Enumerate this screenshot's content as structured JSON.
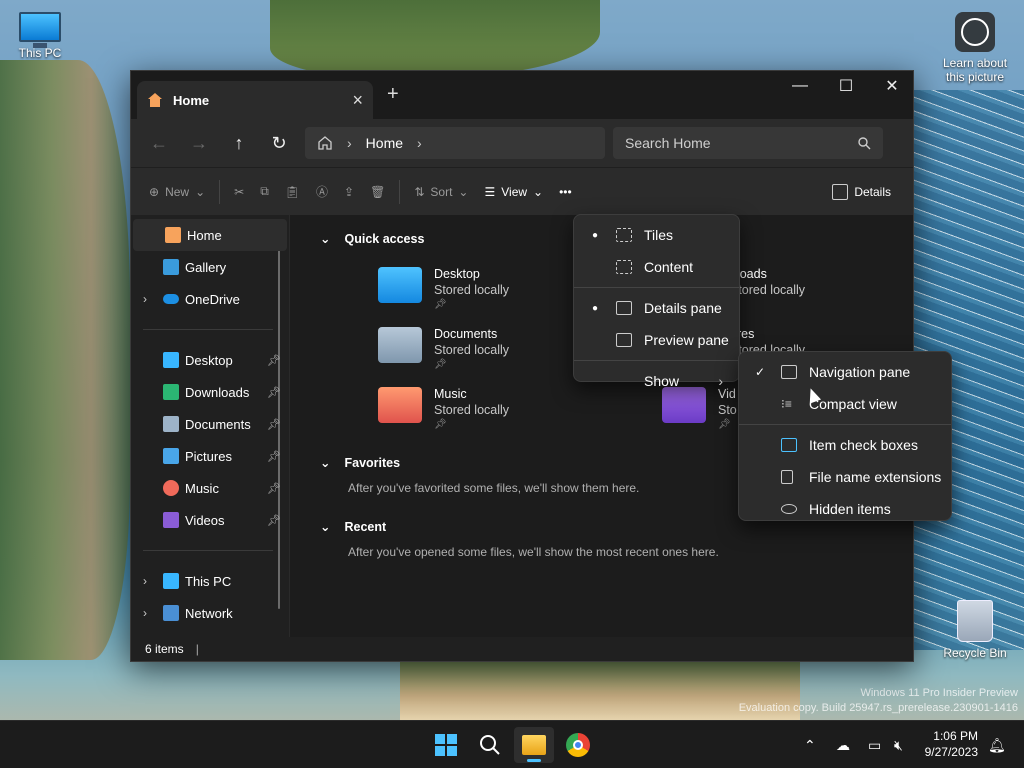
{
  "desktop": {
    "this_pc_label": "This PC",
    "learn_label": "Learn about this picture",
    "recycle_label": "Recycle Bin",
    "watermark_line1": "Windows 11 Pro Insider Preview",
    "watermark_line2": "Evaluation copy. Build 25947.rs_prerelease.230901-1416"
  },
  "window": {
    "tab_title": "Home",
    "new_tab": "+",
    "controls": {
      "minimize": "—",
      "maximize": "☐",
      "close": "✕"
    },
    "address": {
      "crumb": "Home"
    },
    "search_placeholder": "Search Home",
    "command_bar": {
      "new_label": "New",
      "sort_label": "Sort",
      "view_label": "View",
      "more_label": "•••",
      "details_label": "Details"
    },
    "nav_pane": {
      "items_top": [
        {
          "label": "Home",
          "icon": "home-icon"
        },
        {
          "label": "Gallery",
          "icon": "gallery-icon"
        },
        {
          "label": "OneDrive",
          "icon": "cloud-icon"
        }
      ],
      "pinned": [
        {
          "label": "Desktop",
          "icon": "desktop-icon"
        },
        {
          "label": "Downloads",
          "icon": "download-icon"
        },
        {
          "label": "Documents",
          "icon": "document-icon"
        },
        {
          "label": "Pictures",
          "icon": "picture-icon"
        },
        {
          "label": "Music",
          "icon": "music-icon"
        },
        {
          "label": "Videos",
          "icon": "video-icon"
        }
      ],
      "items_bottom": [
        {
          "label": "This PC",
          "icon": "pc-icon"
        },
        {
          "label": "Network",
          "icon": "network-icon"
        }
      ]
    },
    "content": {
      "quick_access": "Quick access",
      "tiles": [
        {
          "name": "Desktop",
          "sub": "Stored locally"
        },
        {
          "name": "Documents",
          "sub": "Stored locally"
        },
        {
          "name": "Music",
          "sub": "Stored locally"
        },
        {
          "name": "nloads",
          "sub": "Stored locally"
        },
        {
          "name": "ures",
          "sub": "Stored locally"
        },
        {
          "name": "Vid",
          "sub": "Sto"
        }
      ],
      "favorites": "Favorites",
      "favorites_hint": "After you've favorited some files, we'll show them here.",
      "recent": "Recent",
      "recent_hint": "After you've opened some files, we'll show the most recent ones here."
    },
    "status": "6 items"
  },
  "view_menu": {
    "items": [
      {
        "label": "Tiles",
        "selected": true
      },
      {
        "label": "Content",
        "selected": false
      },
      {
        "label": "Details pane",
        "selected": true
      },
      {
        "label": "Preview pane",
        "selected": false
      },
      {
        "label": "Show",
        "has_submenu": true
      }
    ]
  },
  "show_submenu": {
    "items": [
      {
        "label": "Navigation pane",
        "checked": true
      },
      {
        "label": "Compact view",
        "checked": false
      },
      {
        "label": "Item check boxes",
        "checked": false
      },
      {
        "label": "File name extensions",
        "checked": false
      },
      {
        "label": "Hidden items",
        "checked": false
      }
    ]
  },
  "taskbar": {
    "time": "1:06 PM",
    "date": "9/27/2023"
  },
  "colors": {
    "accent": "#4cc2ff",
    "window_bg": "#202020",
    "menu_bg": "#2c2c2c"
  }
}
